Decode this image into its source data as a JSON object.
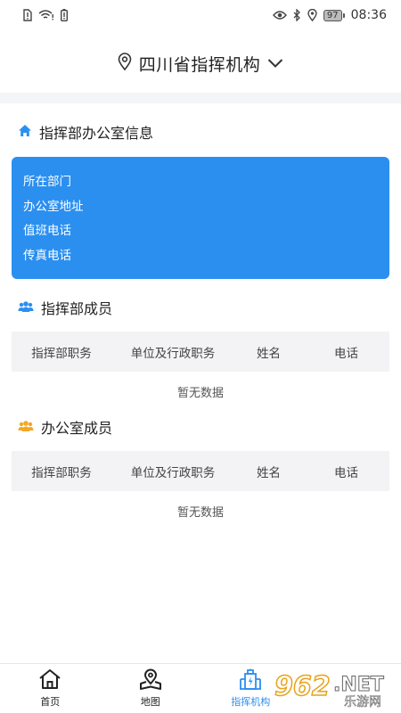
{
  "status_bar": {
    "time": "08:36",
    "battery": "97"
  },
  "header": {
    "title": "四川省指挥机构"
  },
  "office_info": {
    "title": "指挥部办公室信息",
    "rows": [
      "所在部门",
      "办公室地址",
      "值班电话",
      "传真电话"
    ]
  },
  "command_members": {
    "title": "指挥部成员",
    "columns": [
      "指挥部职务",
      "单位及行政职务",
      "姓名",
      "电话"
    ],
    "empty_text": "暂无数据"
  },
  "office_members": {
    "title": "办公室成员",
    "columns": [
      "指挥部职务",
      "单位及行政职务",
      "姓名",
      "电话"
    ],
    "empty_text": "暂无数据"
  },
  "bottom_nav": {
    "items": [
      {
        "label": "首页",
        "icon": "home-icon"
      },
      {
        "label": "地图",
        "icon": "map-pin-icon"
      },
      {
        "label": "指挥机构",
        "icon": "building-icon",
        "active": true
      },
      {
        "label": "",
        "icon": ""
      }
    ]
  },
  "watermark": {
    "text": "962",
    "suffix": "NET",
    "subtitle": "乐游网"
  },
  "colors": {
    "accent": "#2b8ff0",
    "orange": "#f5a623",
    "band": "#f4f5f9"
  }
}
